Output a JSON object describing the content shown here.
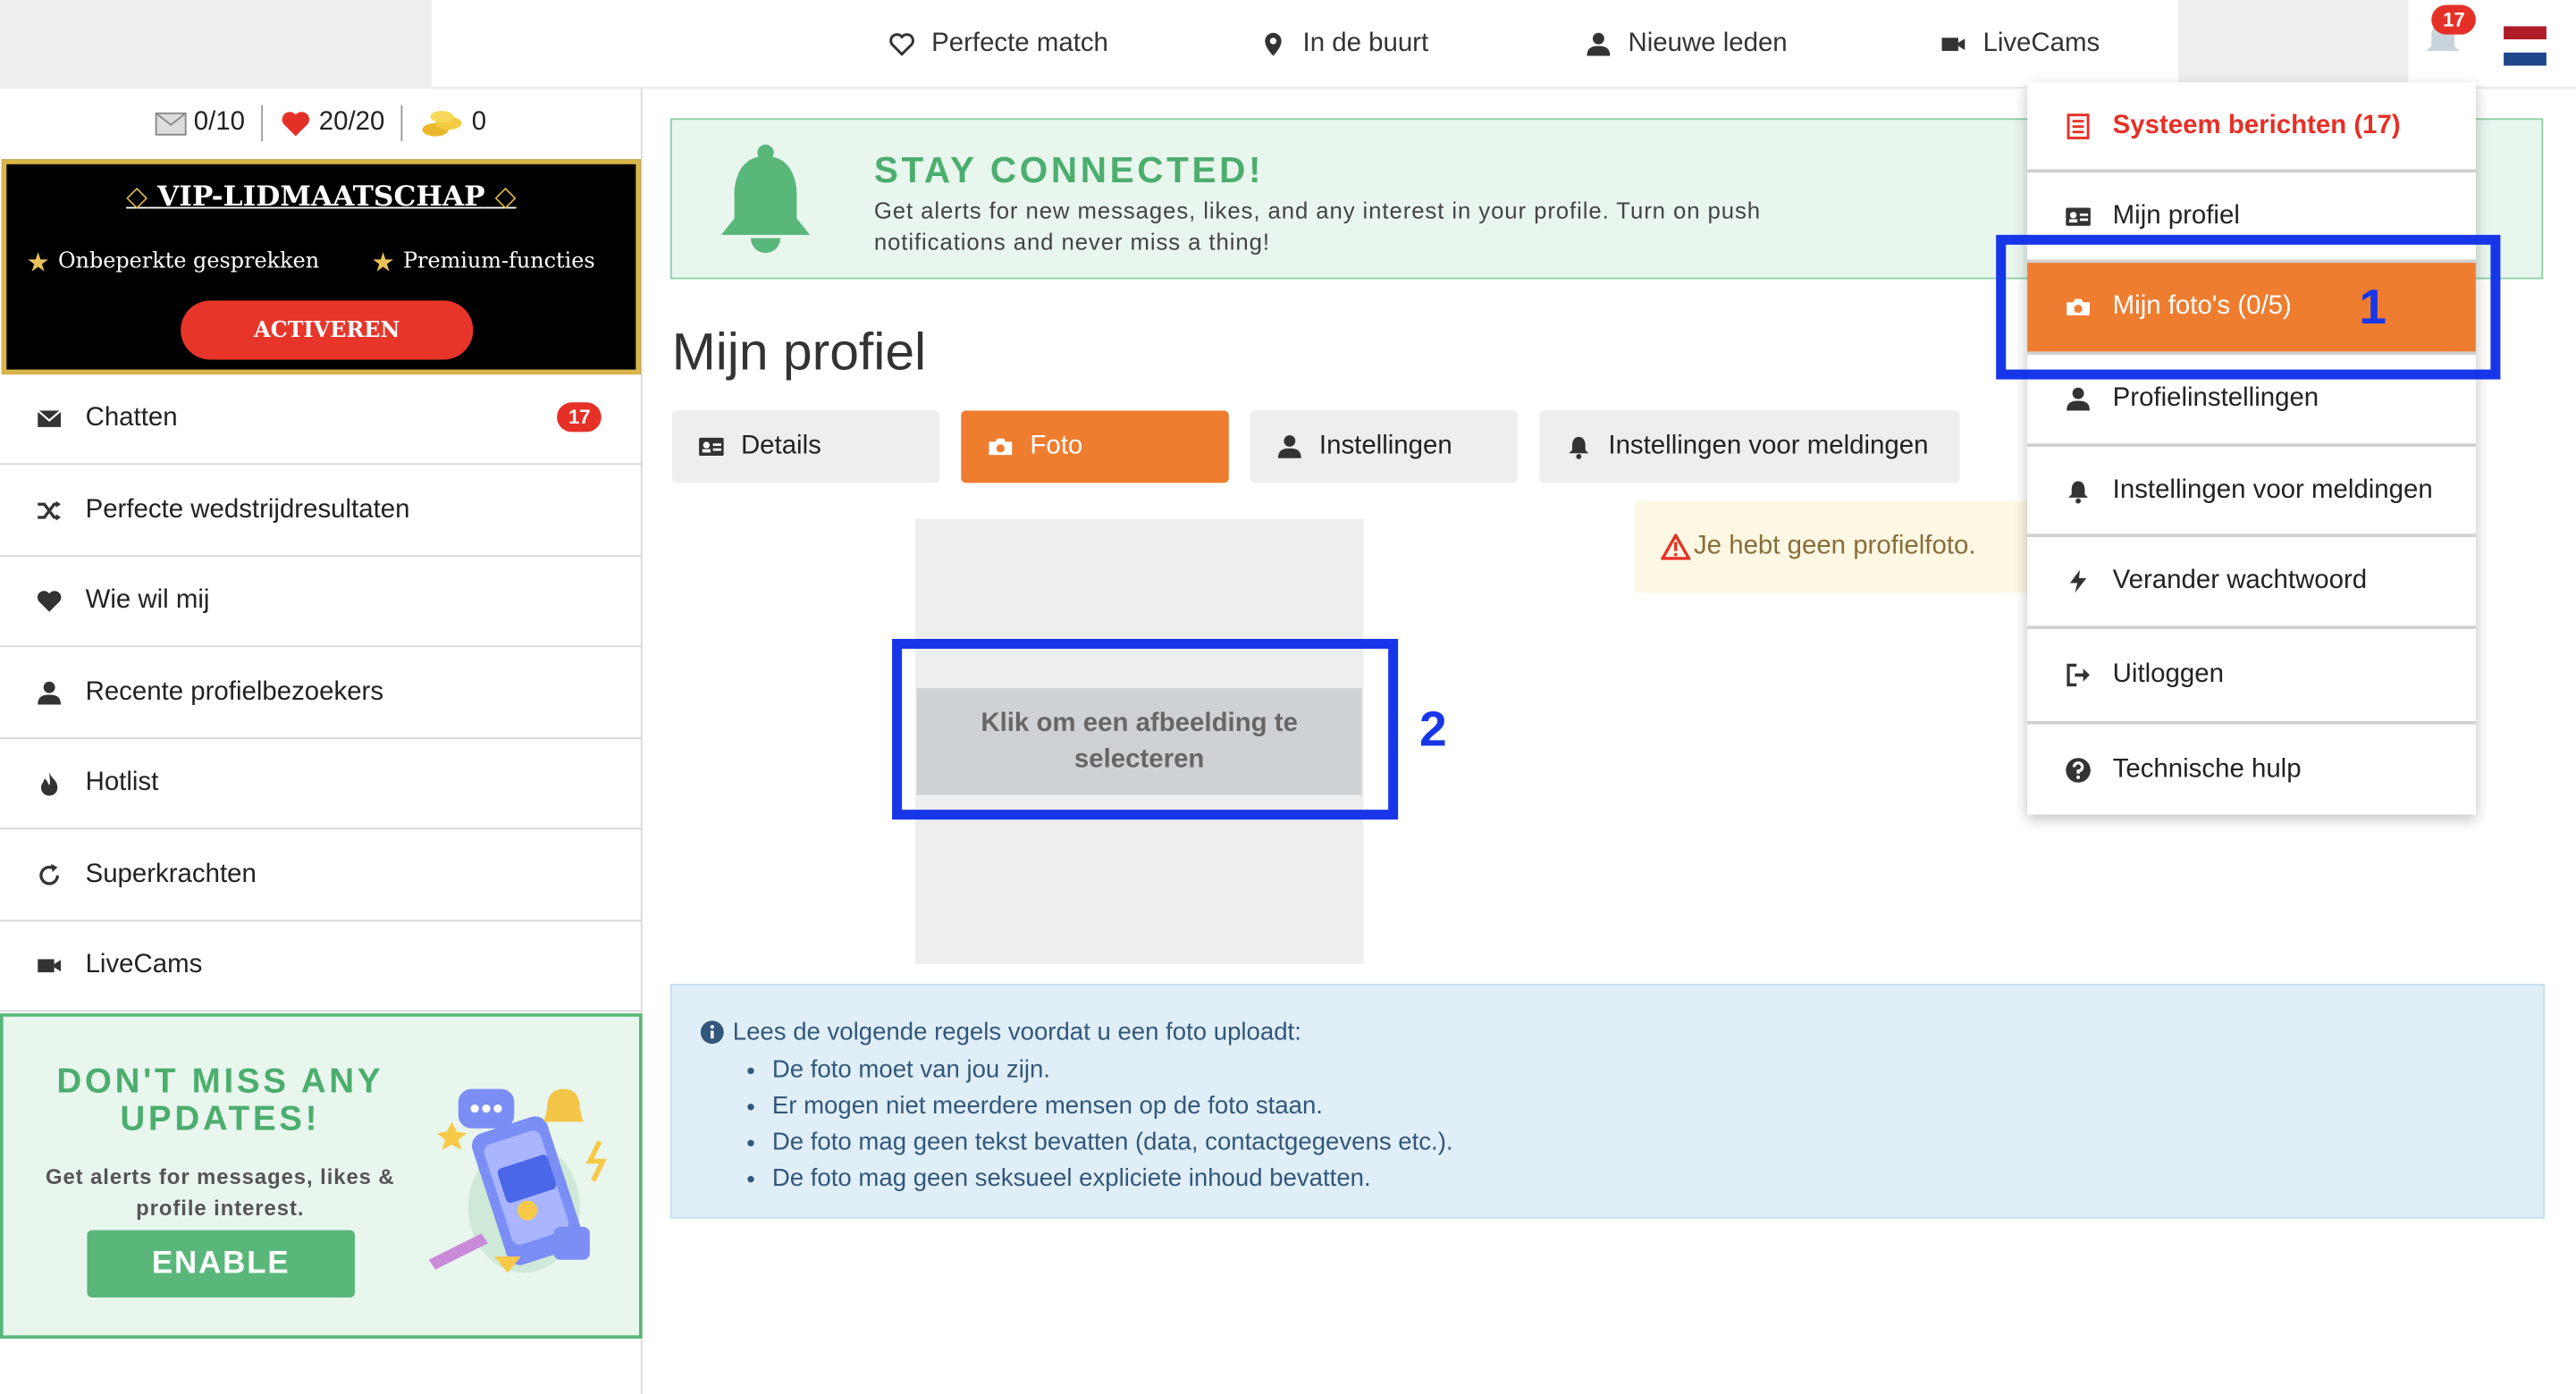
{
  "topnav": {
    "items": [
      {
        "label": "Perfecte match",
        "icon": "heart-outline-icon"
      },
      {
        "label": "In de buurt",
        "icon": "map-pin-icon"
      },
      {
        "label": "Nieuwe leden",
        "icon": "user-icon"
      },
      {
        "label": "LiveCams",
        "icon": "video-camera-icon"
      }
    ],
    "notification_count": "17"
  },
  "sidebar": {
    "stats": {
      "messages": "0/10",
      "likes": "20/20",
      "coins": "0"
    },
    "vip": {
      "title": "VIP-LIDMAATSCHAP",
      "feature_1": "Onbeperkte gesprekken",
      "feature_2": "Premium-functies",
      "button": "ACTIVEREN"
    },
    "items": [
      {
        "label": "Chatten",
        "icon": "envelope-icon",
        "badge": "17"
      },
      {
        "label": "Perfecte wedstrijdresultaten",
        "icon": "shuffle-icon"
      },
      {
        "label": "Wie wil mij",
        "icon": "heart-icon"
      },
      {
        "label": "Recente profielbezoekers",
        "icon": "user-icon"
      },
      {
        "label": "Hotlist",
        "icon": "fire-icon"
      },
      {
        "label": "Superkrachten",
        "icon": "refresh-icon"
      },
      {
        "label": "LiveCams",
        "icon": "video-camera-icon"
      }
    ],
    "promo": {
      "title": "DON'T MISS ANY UPDATES!",
      "text": "Get alerts for messages, likes & profile interest.",
      "button": "ENABLE"
    }
  },
  "banner": {
    "title": "STAY CONNECTED!",
    "text": "Get alerts for new messages, likes, and any interest in your profile. Turn on push notifications and never miss a thing!"
  },
  "page": {
    "title": "Mijn profiel",
    "tabs": [
      {
        "label": "Details",
        "icon": "id-card-icon"
      },
      {
        "label": "Foto",
        "icon": "camera-icon",
        "active": true
      },
      {
        "label": "Instellingen",
        "icon": "user-icon"
      },
      {
        "label": "Instellingen voor meldingen",
        "icon": "bell-icon"
      }
    ],
    "select_button": "Klik om een afbeelding te selecteren",
    "warning": "Je hebt geen profielfoto.",
    "rules": {
      "heading": "Lees de volgende regels voordat u een foto uploadt:",
      "items": [
        "De foto moet van jou zijn.",
        "Er mogen niet meerdere mensen op de foto staan.",
        "De foto mag geen tekst bevatten (data, contactgegevens etc.).",
        "De foto mag geen seksueel expliciete inhoud bevatten."
      ]
    }
  },
  "dropdown": {
    "items": [
      {
        "label": "Systeem berichten (17)",
        "icon": "list-icon"
      },
      {
        "label": "Mijn profiel",
        "icon": "id-card-icon"
      },
      {
        "label": "Mijn foto's (0/5)",
        "icon": "camera-icon",
        "active": true
      },
      {
        "label": "Profielinstellingen",
        "icon": "user-icon"
      },
      {
        "label": "Instellingen voor meldingen",
        "icon": "bell-icon"
      },
      {
        "label": "Verander wachtwoord",
        "icon": "bolt-icon"
      },
      {
        "label": "Uitloggen",
        "icon": "sign-out-icon"
      },
      {
        "label": "Technische hulp",
        "icon": "question-circle-icon"
      }
    ]
  },
  "annotations": {
    "marker_1": "1",
    "marker_2": "2"
  },
  "colors": {
    "accent": "#ee7d30",
    "alert": "#e53027",
    "green": "#5ab77a",
    "annotation": "#1736e8"
  }
}
